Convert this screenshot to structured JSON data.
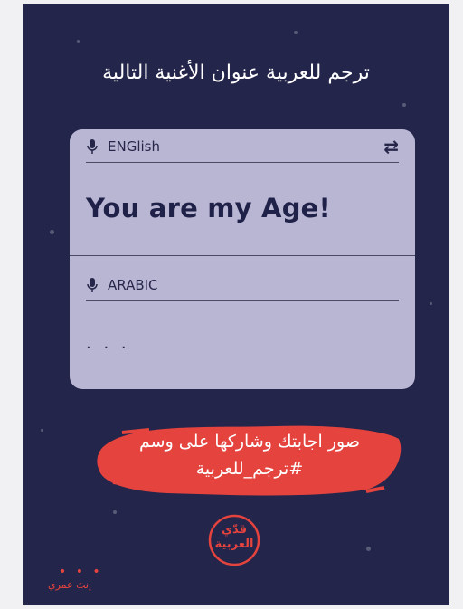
{
  "headline": "ترجم للعربية عنوان الأغنية التالية",
  "translator": {
    "source_language": "ENGlish",
    "source_text": "You are my Age!",
    "target_language": "ARABIC",
    "target_text": ". . .",
    "swap_icon": "swap-arrows-icon",
    "mic_icon": "microphone-icon"
  },
  "call_to_action": {
    "line1": "صور اجابتك وشاركها على وسم",
    "line2": "#ترجم_للعربية"
  },
  "logo": {
    "line1": "قدّي",
    "line2": "العربية"
  },
  "footer": {
    "dots": "• • •",
    "text": "إنتَ عمري"
  },
  "colors": {
    "background": "#23254a",
    "card": "#b9b6d3",
    "accent": "#e4433e"
  }
}
